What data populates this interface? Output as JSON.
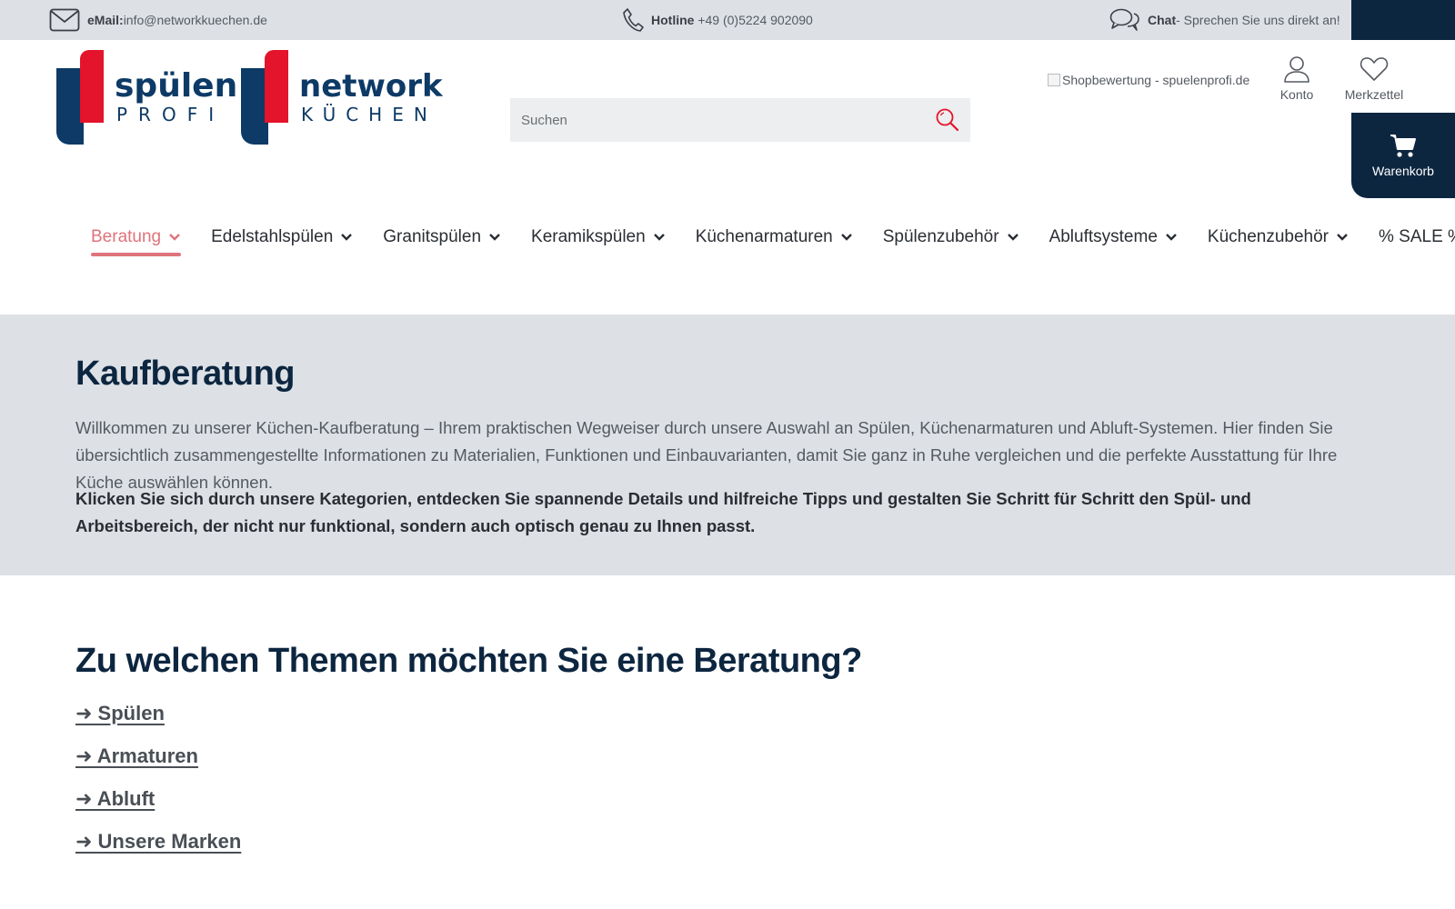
{
  "topbar": {
    "email_label": "eMail:",
    "email_value": "info@networkkuechen.de",
    "hotline_label": "Hotline",
    "hotline_value": "+49 (0)5224 902090",
    "chat_label": "Chat",
    "chat_value": " - Sprechen Sie uns direkt an!"
  },
  "logos": [
    {
      "line1": "spülen",
      "line2": "PROFI"
    },
    {
      "line1": "network",
      "line2": "KÜCHEN"
    }
  ],
  "search": {
    "placeholder": "Suchen"
  },
  "rating_alt": "Shopbewertung - spuelenprofi.de",
  "header": {
    "account_label": "Konto",
    "wishlist_label": "Merkzettel",
    "cart_label": "Warenkorb"
  },
  "nav": {
    "items": [
      {
        "label": "Beratung",
        "active": true
      },
      {
        "label": "Edelstahlspülen"
      },
      {
        "label": "Granitspülen"
      },
      {
        "label": "Keramikspülen"
      },
      {
        "label": "Küchenarmaturen"
      },
      {
        "label": "Spülenzubehör"
      },
      {
        "label": "Abluftsysteme"
      },
      {
        "label": "Küchenzubehör"
      },
      {
        "label": "% SALE %"
      }
    ]
  },
  "hero": {
    "title": "Kaufberatung",
    "intro": "Willkommen zu unserer Küchen-Kaufberatung – Ihrem praktischen Wegweiser durch unsere Auswahl an Spülen, Küchenarmaturen und Abluft-Systemen. Hier finden Sie übersichtlich zusammengestellte Informationen zu Materialien, Funktionen und Einbauvarianten, damit Sie ganz in Ruhe vergleichen und die perfekte Ausstattung für Ihre Küche auswählen können.",
    "cta": "Klicken Sie sich durch unsere Kategorien, entdecken Sie spannende Details und hilfreiche Tipps und gestalten Sie Schritt für Schritt den Spül- und Arbeitsbereich, der nicht nur funktional, sondern auch optisch genau zu Ihnen passt."
  },
  "topics": {
    "title": "Zu welchen Themen möchten Sie eine Beratung?",
    "links": [
      "➜ Spülen",
      "➜ Armaturen",
      "➜ Abluft",
      "➜ Unsere Marken"
    ]
  },
  "colors": {
    "navy": "#0d2640",
    "brand_red": "#e3142b",
    "active_nav": "#e0737b",
    "band_gray": "#dde1e6"
  }
}
